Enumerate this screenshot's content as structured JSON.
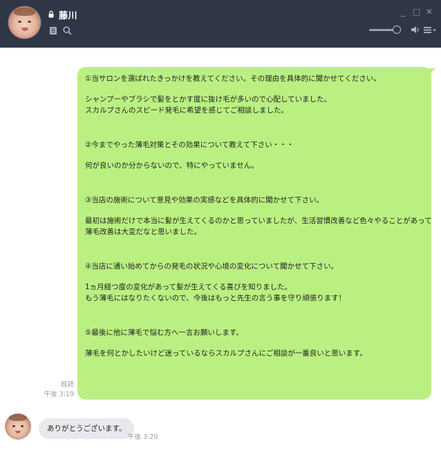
{
  "header": {
    "contact_name": "藤川",
    "icons": [
      "lock-icon",
      "note-icon",
      "search-icon",
      "minimize-icon",
      "maximize-icon",
      "close-icon",
      "speaker-icon",
      "menu-icon"
    ],
    "window_buttons": {
      "minimize": "_",
      "maximize": "□",
      "close": "✕"
    },
    "volume_level": 0.9,
    "colors": {
      "background": "#2f3747",
      "text": "#ffffff"
    }
  },
  "chat": {
    "outgoing_message": {
      "blocks": [
        [
          "①当サロンを選ばれたきっかけを教えてください。その理由を具体的に聞かせてください。"
        ],
        [
          "シャンプーやブラシで髪をとかす度に抜け毛が多いので心配していました。",
          "スカルプさんのスピード発毛に希望を感じてご相談しました。"
        ],
        [
          "②今までやった薄毛対策とその効果について教えて下さい・・・"
        ],
        [
          "何が良いのか分からないので、特にやっていません。"
        ],
        [
          "③当店の施術について意見や効果の実感などを具体的に聞かせて下さい。"
        ],
        [
          "最初は施術だけで本当に髪が生えてくるのかと思っていましたが、生活習慣改善など色々やることがあって",
          "薄毛改善は大変だなと思いました。"
        ],
        [
          "④当店に通い始めてからの発毛の状況や心境の変化について聞かせて下さい。"
        ],
        [
          "1ヵ月経つ度の変化があって髪が生えてくる喜びを知りました。",
          "もう薄毛にはなりたくないので、今後はもっと先生の言う事を守り頑張ります！"
        ],
        [
          "⑤最後に他に薄毛で悩む方へ一言お願いします。"
        ],
        [
          "薄毛を何とかしたいけど迷っているならスカルプさんにご相談が一番良いと思います。"
        ]
      ],
      "read_status": "既読",
      "time": "午後 3:19",
      "bubble_color": "#baf081"
    },
    "incoming_message": {
      "text": "ありがとうございます。",
      "time": "午後 3:20",
      "bubble_color": "#e8e9ec"
    }
  }
}
